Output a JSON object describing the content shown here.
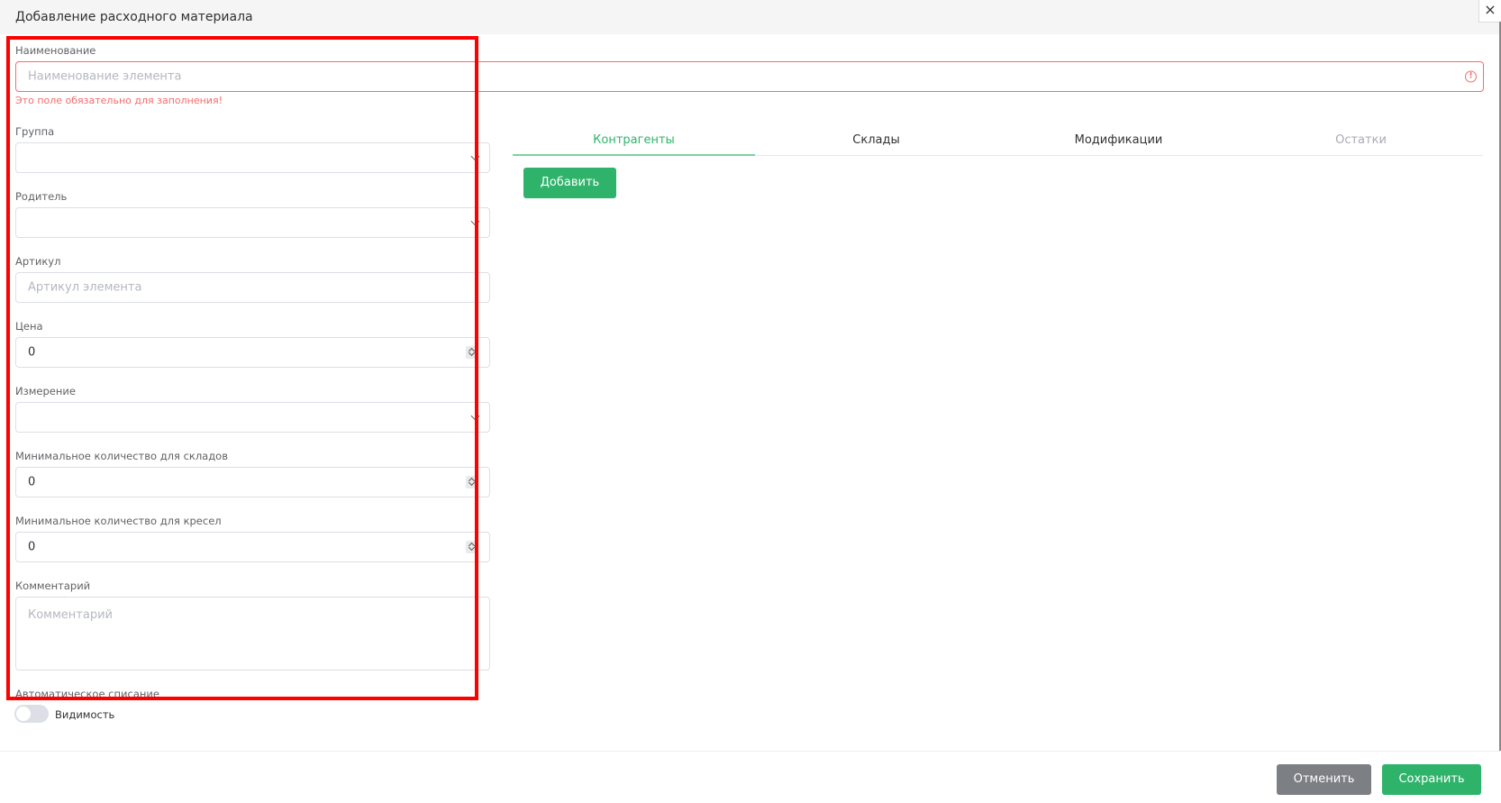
{
  "modal": {
    "title": "Добавление расходного материала",
    "close_glyph": "×"
  },
  "form": {
    "name": {
      "label": "Наименование",
      "placeholder": "Наименование элемента",
      "error": "Это поле обязательно для заполнения!",
      "error_glyph": "!"
    },
    "group": {
      "label": "Группа",
      "value": ""
    },
    "parent": {
      "label": "Родитель",
      "value": ""
    },
    "article": {
      "label": "Артикул",
      "placeholder": "Артикул элемента"
    },
    "price": {
      "label": "Цена",
      "value": "0"
    },
    "unit": {
      "label": "Измерение",
      "value": ""
    },
    "min_warehouse": {
      "label": "Минимальное количество для складов",
      "value": "0"
    },
    "min_chair": {
      "label": "Минимальное количество для кресел",
      "value": "0"
    },
    "comment": {
      "label": "Комментарий",
      "placeholder": "Комментарий"
    },
    "auto_writeoff": {
      "label": "Автоматическое списание",
      "toggle_label": "Видимость",
      "enabled": false
    }
  },
  "tabs": [
    {
      "label": "Контрагенты",
      "state": "active"
    },
    {
      "label": "Склады",
      "state": "normal"
    },
    {
      "label": "Модификации",
      "state": "normal"
    },
    {
      "label": "Остатки",
      "state": "disabled"
    }
  ],
  "tab_content": {
    "add_button": "Добавить"
  },
  "footer": {
    "cancel": "Отменить",
    "save": "Сохранить"
  },
  "colors": {
    "primary": "#2fb36b",
    "error": "#f56c6c",
    "highlight": "#ff0000",
    "cancel": "#7c7f84"
  }
}
